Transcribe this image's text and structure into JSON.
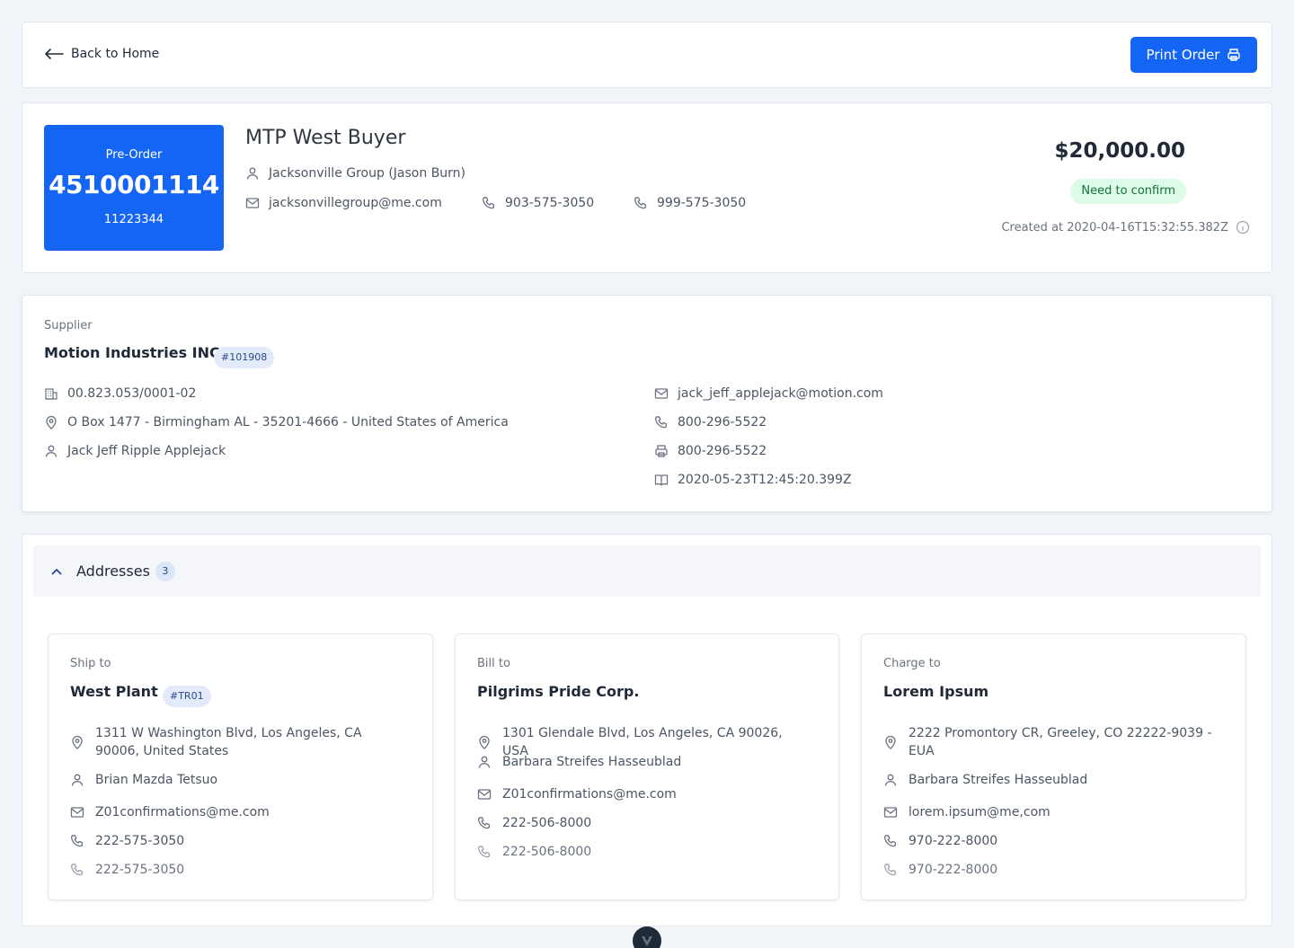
{
  "topbar": {
    "back_label": "Back to Home",
    "print_label": "Print Order"
  },
  "order": {
    "badge_label": "Pre-Order",
    "number": "4510001114",
    "sub_number": "11223344",
    "buyer_name": "MTP West Buyer",
    "contact_person": "Jacksonville Group (Jason Burn)",
    "email": "jacksonvillegroup@me.com",
    "phone_1": "903-575-3050",
    "phone_2": "999-575-3050",
    "total": "$20,000.00",
    "status": "Need to confirm",
    "created": "Created at 2020-04-16T15:32:55.382Z",
    "colors": {
      "badge_bg": "#1565f5",
      "status_bg": "#dcfce7",
      "status_text": "#14703a"
    }
  },
  "supplier": {
    "section_label": "Supplier",
    "name": "Motion Industries INC",
    "tag": "#101908",
    "tax_id": "00.823.053/0001-02",
    "address": "O Box 1477 - Birmingham AL - 35201-4666 - United States of America",
    "contact": "Jack Jeff Ripple Applejack",
    "email": "jack_jeff_applejack@motion.com",
    "phone": "800-296-5522",
    "fax": "800-296-5522",
    "date": "2020-05-23T12:45:20.399Z"
  },
  "addresses": {
    "title": "Addresses",
    "count": "3",
    "cards": [
      {
        "label": "Ship to",
        "name": "West Plant",
        "tag": "#TR01",
        "address": "1311 W Washington Blvd, Los Angeles, CA 90006, United States",
        "contact": "Brian Mazda Tetsuo",
        "email": "Z01confirmations@me.com",
        "phone": "222-575-3050",
        "phone_alt": "222-575-3050"
      },
      {
        "label": "Bill to",
        "name": "Pilgrims Pride Corp.",
        "address": "1301 Glendale Blvd, Los Angeles, CA 90026, USA",
        "contact": "Barbara Streifes Hasseublad",
        "email": "Z01confirmations@me.com",
        "phone": "222-506-8000",
        "phone_alt": "222-506-8000"
      },
      {
        "label": "Charge to",
        "name": "Lorem Ipsum",
        "address": "2222 Promontory CR, Greeley, CO 22222-9039 - EUA",
        "contact": "Barbara Streifes Hasseublad",
        "email": "lorem.ipsum@me,com",
        "phone": "970-222-8000",
        "phone_alt": "970-222-8000"
      }
    ]
  },
  "icons": {
    "back": "arrow-left-icon",
    "print": "printer-icon",
    "user": "user-icon",
    "mail": "mail-icon",
    "phone": "phone-icon",
    "building": "building-icon",
    "location": "map-pin-icon",
    "fax": "printer-icon",
    "date": "book-icon",
    "info": "info-icon",
    "chevron": "chevron-up-icon"
  }
}
